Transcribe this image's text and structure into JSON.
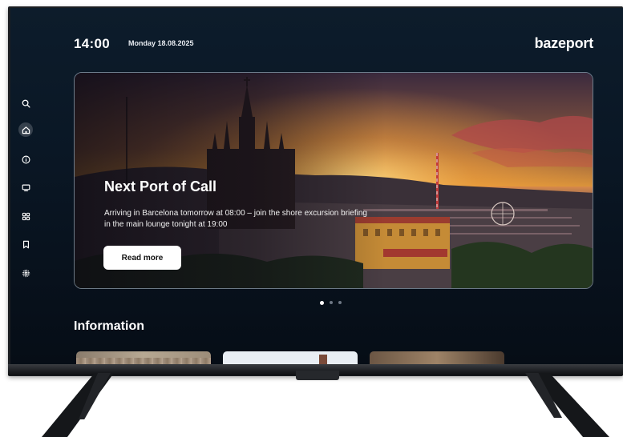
{
  "status_bar": {
    "time": "14:00",
    "date": "Monday 18.08.2025",
    "brand": "bazeport"
  },
  "sidebar": {
    "items": [
      {
        "icon": "search-icon",
        "active": false
      },
      {
        "icon": "home-icon",
        "active": true
      },
      {
        "icon": "info-icon",
        "active": false
      },
      {
        "icon": "tv-icon",
        "active": false
      },
      {
        "icon": "apps-grid-icon",
        "active": false
      },
      {
        "icon": "bookmark-icon",
        "active": false
      },
      {
        "icon": "settings-icon",
        "active": false
      }
    ]
  },
  "hero": {
    "title": "Next Port of Call",
    "description": "Arriving in Barcelona tomorrow at 08:00 – join the shore excursion briefing in the main lounge tonight at 19:00",
    "button_label": "Read more",
    "pager": {
      "count": 3,
      "active_index": 0
    }
  },
  "information": {
    "title": "Information",
    "cards": [
      {
        "image": "aerial-city-roofs"
      },
      {
        "image": "white-building-landmark"
      },
      {
        "image": "old-town-street"
      }
    ]
  },
  "colors": {
    "screen_background": "#0a1725",
    "accent_text": "#ffffff",
    "button_background": "#ffffff"
  }
}
